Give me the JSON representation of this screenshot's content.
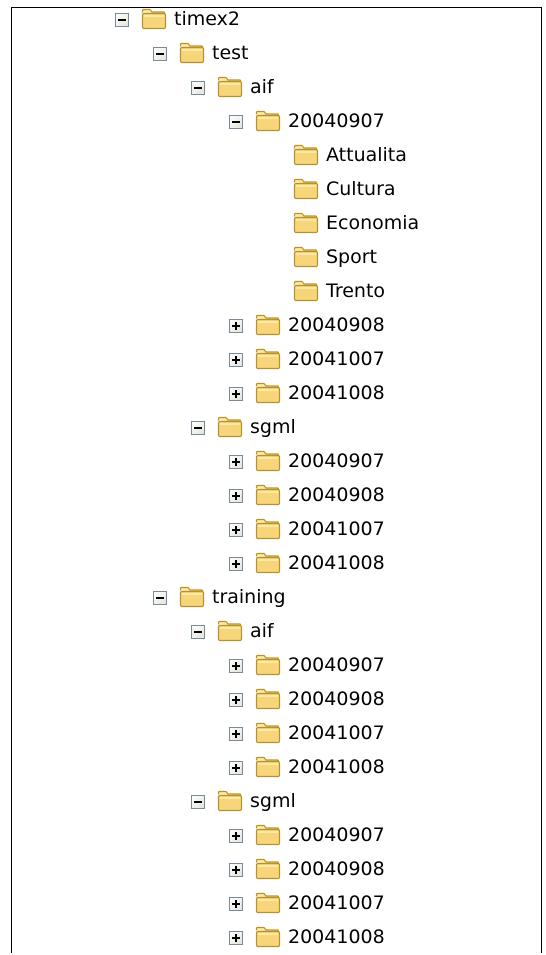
{
  "tree": {
    "rows": [
      {
        "label": "timex2",
        "depth": 0,
        "expander": "minus",
        "icon": "folder-icon"
      },
      {
        "label": "test",
        "depth": 1,
        "expander": "minus",
        "icon": "folder-icon"
      },
      {
        "label": "aif",
        "depth": 2,
        "expander": "minus",
        "icon": "folder-icon"
      },
      {
        "label": "20040907",
        "depth": 3,
        "expander": "minus",
        "icon": "folder-icon"
      },
      {
        "label": "Attualita",
        "depth": 4,
        "expander": "none",
        "icon": "folder-icon"
      },
      {
        "label": "Cultura",
        "depth": 4,
        "expander": "none",
        "icon": "folder-icon"
      },
      {
        "label": "Economia",
        "depth": 4,
        "expander": "none",
        "icon": "folder-icon"
      },
      {
        "label": "Sport",
        "depth": 4,
        "expander": "none",
        "icon": "folder-icon"
      },
      {
        "label": "Trento",
        "depth": 4,
        "expander": "none",
        "icon": "folder-icon"
      },
      {
        "label": "20040908",
        "depth": 3,
        "expander": "plus",
        "icon": "folder-icon"
      },
      {
        "label": "20041007",
        "depth": 3,
        "expander": "plus",
        "icon": "folder-icon"
      },
      {
        "label": "20041008",
        "depth": 3,
        "expander": "plus",
        "icon": "folder-icon"
      },
      {
        "label": "sgml",
        "depth": 2,
        "expander": "minus",
        "icon": "folder-icon"
      },
      {
        "label": "20040907",
        "depth": 3,
        "expander": "plus",
        "icon": "folder-icon"
      },
      {
        "label": "20040908",
        "depth": 3,
        "expander": "plus",
        "icon": "folder-icon"
      },
      {
        "label": "20041007",
        "depth": 3,
        "expander": "plus",
        "icon": "folder-icon"
      },
      {
        "label": "20041008",
        "depth": 3,
        "expander": "plus",
        "icon": "folder-icon"
      },
      {
        "label": "training",
        "depth": 1,
        "expander": "minus",
        "icon": "folder-icon"
      },
      {
        "label": "aif",
        "depth": 2,
        "expander": "minus",
        "icon": "folder-icon"
      },
      {
        "label": "20040907",
        "depth": 3,
        "expander": "plus",
        "icon": "folder-icon"
      },
      {
        "label": "20040908",
        "depth": 3,
        "expander": "plus",
        "icon": "folder-icon"
      },
      {
        "label": "20041007",
        "depth": 3,
        "expander": "plus",
        "icon": "folder-icon"
      },
      {
        "label": "20041008",
        "depth": 3,
        "expander": "plus",
        "icon": "folder-icon"
      },
      {
        "label": "sgml",
        "depth": 2,
        "expander": "minus",
        "icon": "folder-icon"
      },
      {
        "label": "20040907",
        "depth": 3,
        "expander": "plus",
        "icon": "folder-icon"
      },
      {
        "label": "20040908",
        "depth": 3,
        "expander": "plus",
        "icon": "folder-icon"
      },
      {
        "label": "20041007",
        "depth": 3,
        "expander": "plus",
        "icon": "folder-icon"
      },
      {
        "label": "20041008",
        "depth": 3,
        "expander": "plus",
        "icon": "folder-icon"
      }
    ]
  },
  "colors": {
    "folder_fill": "#f7d67b",
    "folder_fill_light": "#fbe9a9",
    "folder_outline": "#b8912a",
    "expander_border": "#7a8a99"
  }
}
